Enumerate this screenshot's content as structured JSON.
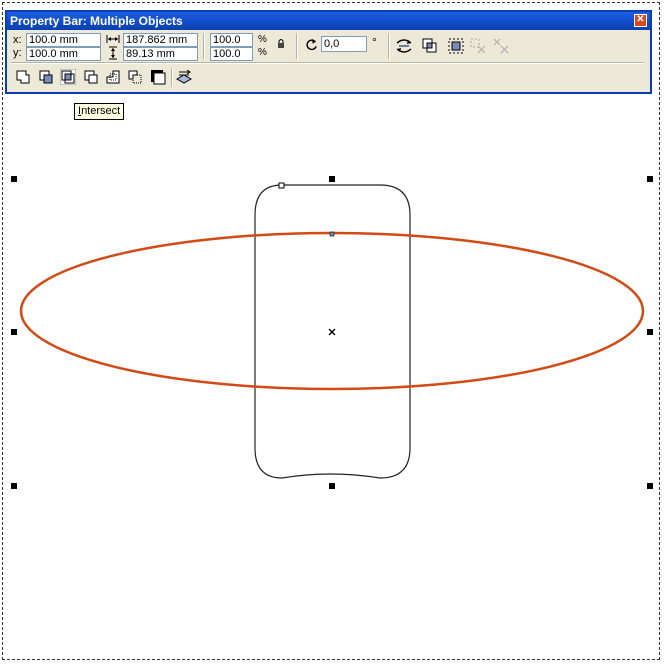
{
  "window": {
    "title": "Property Bar: Multiple Objects",
    "close_glyph": "✕"
  },
  "position": {
    "x_label": "x:",
    "y_label": "y:",
    "x_value": "100.0 mm",
    "y_value": "100.0 mm"
  },
  "size": {
    "width_value": "187.862 mm",
    "height_value": "89.13 mm"
  },
  "scale": {
    "x_value": "100.0",
    "y_value": "100.0",
    "x_unit": "%",
    "y_unit": "%"
  },
  "rotation": {
    "value": "0,0",
    "unit": "°"
  },
  "tooltip": {
    "first_letter": "I",
    "rest": "ntersect"
  },
  "colors": {
    "titlebar": "#0a3fae",
    "ellipse_stroke": "#d24a14",
    "rect_stroke": "#222222"
  },
  "icons": [
    "weld-icon",
    "trim-icon",
    "intersect-icon",
    "simplify-icon",
    "front-minus-back-icon",
    "back-minus-front-icon",
    "create-boundary-icon",
    "convert-to-curves-icon"
  ]
}
